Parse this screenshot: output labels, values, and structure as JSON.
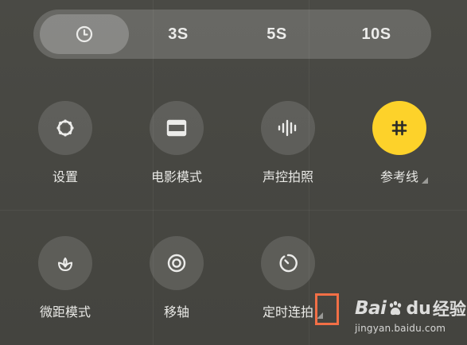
{
  "timer": {
    "options": [
      {
        "label": "",
        "icon": "clock-icon",
        "selected": true
      },
      {
        "label": "3S",
        "selected": false
      },
      {
        "label": "5S",
        "selected": false
      },
      {
        "label": "10S",
        "selected": false
      }
    ]
  },
  "settings_grid": {
    "row1": [
      {
        "label": "设置",
        "icon": "gear-icon"
      },
      {
        "label": "电影模式",
        "icon": "movie-frame-icon"
      },
      {
        "label": "声控拍照",
        "icon": "sound-wave-icon"
      },
      {
        "label": "参考线",
        "icon": "grid-hash-icon",
        "active": true,
        "has_submenu": true
      }
    ],
    "row2": [
      {
        "label": "微距模式",
        "icon": "flower-icon"
      },
      {
        "label": "移轴",
        "icon": "target-ring-icon"
      },
      {
        "label": "定时连拍",
        "icon": "timer-burst-icon",
        "has_submenu": true
      }
    ]
  },
  "colors": {
    "accent_yellow": "#fdd22a",
    "annotation_orange": "#f26f46"
  },
  "watermark": {
    "brand_bai": "Bai",
    "brand_du": "du",
    "brand_jingyan": "经验",
    "url": "jingyan.baidu.com"
  }
}
